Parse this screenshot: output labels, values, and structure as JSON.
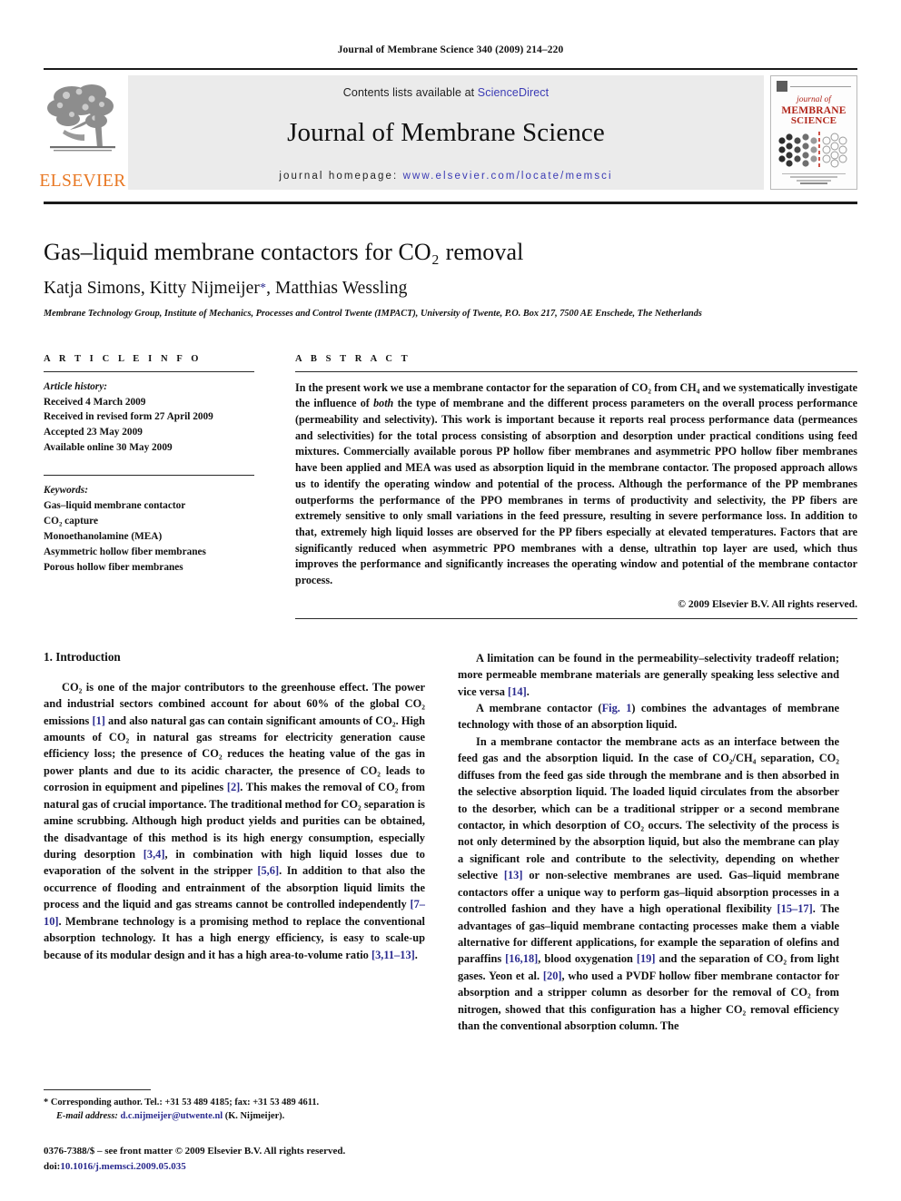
{
  "running_head": "Journal of Membrane Science 340 (2009) 214–220",
  "masthead": {
    "publisher": "ELSEVIER",
    "contents_prefix": "Contents lists available at",
    "contents_link": "ScienceDirect",
    "journal_name": "Journal of Membrane Science",
    "homepage_prefix": "journal homepage:",
    "homepage_url": "www.elsevier.com/locate/memsci",
    "cover": {
      "line1": "journal of",
      "line2": "MEMBRANE",
      "line3": "SCIENCE"
    }
  },
  "article": {
    "title": "Gas–liquid membrane contactors for CO₂ removal",
    "authors": "Katja Simons, Kitty Nijmeijer",
    "authors_tail": ", Matthias Wessling",
    "corresponding_marker": "*",
    "affiliation": "Membrane Technology Group, Institute of Mechanics, Processes and Control Twente (IMPACT), University of Twente, P.O. Box 217, 7500 AE Enschede, The Netherlands"
  },
  "article_info": {
    "heading": "A R T I C L E   I N F O",
    "history_label": "Article history:",
    "history": [
      "Received 4 March 2009",
      "Received in revised form 27 April 2009",
      "Accepted 23 May 2009",
      "Available online 30 May 2009"
    ],
    "keywords_label": "Keywords:",
    "keywords": [
      "Gas–liquid membrane contactor",
      "CO₂ capture",
      "Monoethanolamine (MEA)",
      "Asymmetric hollow fiber membranes",
      "Porous hollow fiber membranes"
    ]
  },
  "abstract": {
    "heading": "A B S T R A C T",
    "text_part1": "In the present work we use a membrane contactor for the separation of CO₂ from CH₄ and we systematically investigate the influence of ",
    "emphasis": "both",
    "text_part2": " the type of membrane and the different process parameters on the overall process performance (permeability and selectivity). This work is important because it reports real process performance data (permeances and selectivities) for the total process consisting of absorption and desorption under practical conditions using feed mixtures. Commercially available porous PP hollow fiber membranes and asymmetric PPO hollow fiber membranes have been applied and MEA was used as absorption liquid in the membrane contactor. The proposed approach allows us to identify the operating window and potential of the process. Although the performance of the PP membranes outperforms the performance of the PPO membranes in terms of productivity and selectivity, the PP fibers are extremely sensitive to only small variations in the feed pressure, resulting in severe performance loss. In addition to that, extremely high liquid losses are observed for the PP fibers especially at elevated temperatures. Factors that are significantly reduced when asymmetric PPO membranes with a dense, ultrathin top layer are used, which thus improves the performance and significantly increases the operating window and potential of the membrane contactor process.",
    "copyright": "© 2009 Elsevier B.V. All rights reserved."
  },
  "introduction": {
    "section_title": "1. Introduction",
    "left_paragraph_1_a": "CO₂ is one of the major contributors to the greenhouse effect. The power and industrial sectors combined account for about 60% of the global CO₂ emissions ",
    "ref_1": "[1]",
    "left_paragraph_1_b": " and also natural gas can contain significant amounts of CO₂. High amounts of CO₂ in natural gas streams for electricity generation cause efficiency loss; the presence of CO₂ reduces the heating value of the gas in power plants and due to its acidic character, the presence of CO₂ leads to corrosion in equipment and pipelines ",
    "ref_2": "[2]",
    "left_paragraph_1_c": ". This makes the removal of CO₂ from natural gas of crucial importance. The traditional method for CO₂ separation is amine scrubbing. Although high product yields and purities can be obtained, the disadvantage of this method is its high energy consumption, especially during desorption ",
    "ref_3": "[3,4]",
    "left_paragraph_1_d": ", in combination with high liquid losses due to evaporation of the solvent in the stripper ",
    "ref_4": "[5,6]",
    "left_paragraph_1_e": ". In addition to that also the occurrence of flooding and entrainment of the absorption liquid limits the process and the liquid and gas streams cannot be controlled independently ",
    "ref_5": "[7–10]",
    "left_paragraph_1_f": ". Membrane technology is a promising method to replace the conventional absorption technology. It has a high energy efficiency, is easy to scale-up because of its modular design and it has a high area-to-volume ratio ",
    "ref_6": "[3,11–13]",
    "left_paragraph_1_g": ".",
    "right_paragraph_1_a": "A limitation can be found in the permeability–selectivity tradeoff relation; more permeable membrane materials are generally speaking less selective and vice versa ",
    "ref_7": "[14]",
    "right_paragraph_1_b": ".",
    "right_paragraph_2_a": "A membrane contactor (",
    "fig_link": "Fig. 1",
    "right_paragraph_2_b": ") combines the advantages of membrane technology with those of an absorption liquid.",
    "right_paragraph_3_a": "In a membrane contactor the membrane acts as an interface between the feed gas and the absorption liquid. In the case of CO₂/CH₄ separation, CO₂ diffuses from the feed gas side through the membrane and is then absorbed in the selective absorption liquid. The loaded liquid circulates from the absorber to the desorber, which can be a traditional stripper or a second membrane contactor, in which desorption of CO₂ occurs. The selectivity of the process is not only determined by the absorption liquid, but also the membrane can play a significant role and contribute to the selectivity, depending on whether selective ",
    "ref_8": "[13]",
    "right_paragraph_3_b": " or non-selective membranes are used. Gas–liquid membrane contactors offer a unique way to perform gas–liquid absorption processes in a controlled fashion and they have a high operational flexibility ",
    "ref_9": "[15–17]",
    "right_paragraph_3_c": ". The advantages of gas–liquid membrane contacting processes make them a viable alternative for different applications, for example the separation of olefins and paraffins ",
    "ref_10": "[16,18]",
    "right_paragraph_3_d": ", blood oxygenation ",
    "ref_11": "[19]",
    "right_paragraph_3_e": " and the separation of CO₂ from light gases. Yeon et al. ",
    "ref_12": "[20]",
    "right_paragraph_3_f": ", who used a PVDF hollow fiber membrane contactor for absorption and a stripper column as desorber for the removal of CO₂ from nitrogen, showed that this configuration has a higher CO₂ removal efficiency than the conventional absorption column. The"
  },
  "footnote": {
    "marker": "*",
    "corresponding": "Corresponding author. Tel.: +31 53 489 4185; fax: +31 53 489 4611.",
    "email_label": "E-mail address:",
    "email": "d.c.nijmeijer@utwente.nl",
    "email_suffix": "(K. Nijmeijer)."
  },
  "front_matter": {
    "issn_line": "0376-7388/$ – see front matter © 2009 Elsevier B.V. All rights reserved.",
    "doi_label": "doi:",
    "doi": "10.1016/j.memsci.2009.05.035"
  },
  "colors": {
    "elsevier_orange": "#E87722",
    "link_blue": "#3b3bb5",
    "ref_blue": "#2b2b8f",
    "cover_red": "#B02318",
    "banner_gray": "#ebebeb"
  }
}
